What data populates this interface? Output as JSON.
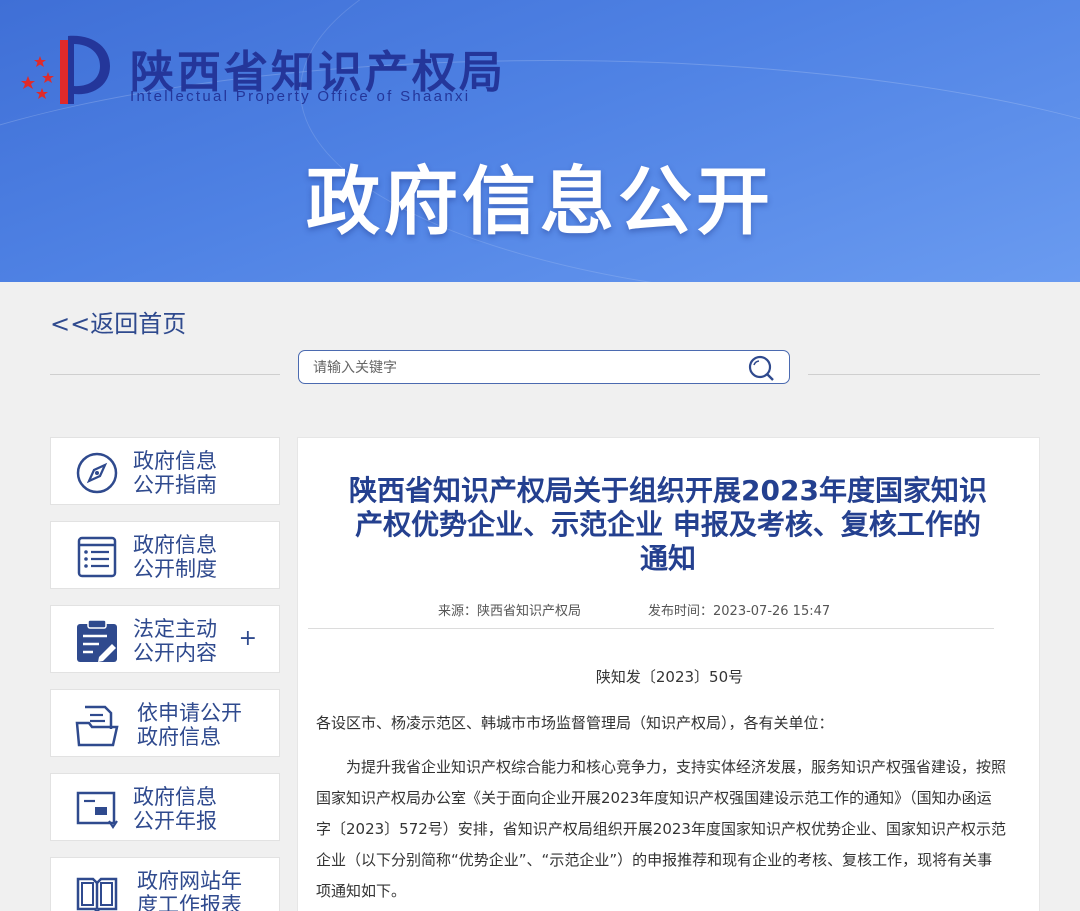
{
  "header": {
    "org_name": "陕西省知识产权局",
    "org_name_en": "Intellectual Property Office of Shaanxi",
    "banner_title": "政府信息公开"
  },
  "nav": {
    "back_label": "<<返回首页"
  },
  "search": {
    "placeholder": "请输入关键字",
    "icon": "search-icon"
  },
  "sidebar": {
    "items": [
      {
        "line1": "政府信息",
        "line2": "公开指南",
        "icon": "compass-icon"
      },
      {
        "line1": "政府信息",
        "line2": "公开制度",
        "icon": "list-document-icon"
      },
      {
        "line1": "法定主动",
        "line2": "公开内容",
        "icon": "clipboard-edit-icon",
        "expand": "+"
      },
      {
        "line1": "依申请公开",
        "line2": "政府信息",
        "icon": "folder-document-icon"
      },
      {
        "line1": "政府信息",
        "line2": "公开年报",
        "icon": "report-icon"
      },
      {
        "line1": "政府网站年",
        "line2": "度工作报表",
        "icon": "book-icon"
      }
    ]
  },
  "article": {
    "title": "陕西省知识产权局关于组织开展2023年度国家知识产权优势企业、示范企业 申报及考核、复核工作的通知",
    "source": "来源：陕西省知识产权局",
    "published": "发布时间：2023-07-26 15:47",
    "doc_number": "陕知发〔2023〕50号",
    "addressee": "各设区市、杨凌示范区、韩城市市场监督管理局（知识产权局），各有关单位：",
    "paragraph": "为提升我省企业知识产权综合能力和核心竞争力，支持实体经济发展，服务知识产权强省建设，按照国家知识产权局办公室《关于面向企业开展2023年度知识产权强国建设示范工作的通知》（国知办函运字〔2023〕572号）安排，省知识产权局组织开展2023年度国家知识产权优势企业、国家知识产权示范企业（以下分别简称“优势企业”、“示范企业”）的申报推荐和现有企业的考核、复核工作，现将有关事项通知如下。"
  },
  "colors": {
    "banner": "#4f82e4",
    "brand_dark": "#24369a",
    "link": "#2f4a8e",
    "logo_red": "#e02a2a"
  }
}
